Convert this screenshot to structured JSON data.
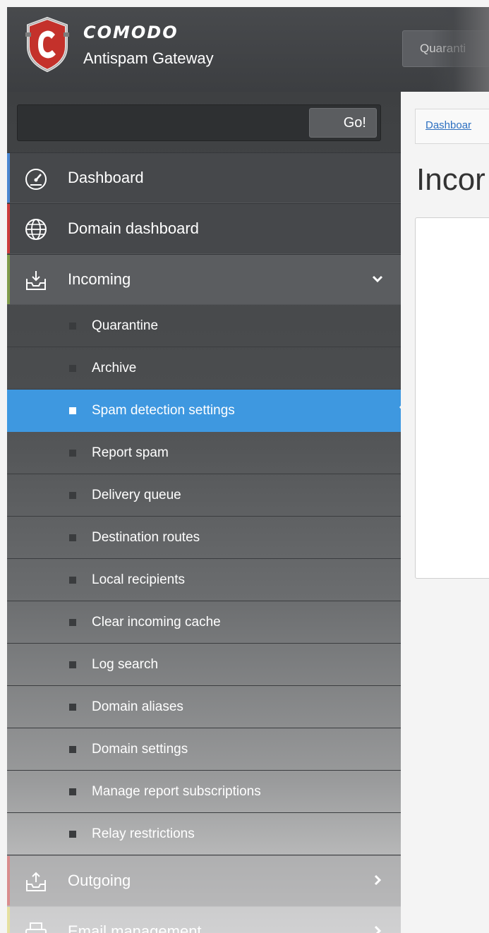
{
  "header": {
    "brand_name": "COMODO",
    "product_name": "Antispam Gateway",
    "top_button_label": "Quaranti"
  },
  "search": {
    "value": "",
    "placeholder": "",
    "go_label": "Go!"
  },
  "nav": {
    "dashboard": {
      "label": "Dashboard",
      "accent": "#4a86d0"
    },
    "domain_dashboard": {
      "label": "Domain dashboard",
      "accent": "#cc3b3b"
    },
    "incoming": {
      "label": "Incoming",
      "accent": "#7f9a4a",
      "expanded": true
    },
    "outgoing": {
      "label": "Outgoing",
      "accent": "#d98d8d"
    },
    "email_management": {
      "label": "Email management",
      "accent": "#e6e0a0"
    }
  },
  "incoming_items": [
    {
      "label": "Quarantine",
      "active": false
    },
    {
      "label": "Archive",
      "active": false
    },
    {
      "label": "Spam detection settings",
      "active": true
    },
    {
      "label": "Report spam",
      "active": false
    },
    {
      "label": "Delivery queue",
      "active": false
    },
    {
      "label": "Destination routes",
      "active": false
    },
    {
      "label": "Local recipients",
      "active": false
    },
    {
      "label": "Clear incoming cache",
      "active": false
    },
    {
      "label": "Log search",
      "active": false
    },
    {
      "label": "Domain aliases",
      "active": false
    },
    {
      "label": "Domain settings",
      "active": false
    },
    {
      "label": "Manage report subscriptions",
      "active": false
    },
    {
      "label": "Relay restrictions",
      "active": false
    }
  ],
  "content": {
    "breadcrumb": "Dashboar",
    "page_title": "Incor"
  },
  "colors": {
    "active_item": "#3e98e0",
    "header_bg": "#424447",
    "sidebar_bg": "#46484a"
  }
}
